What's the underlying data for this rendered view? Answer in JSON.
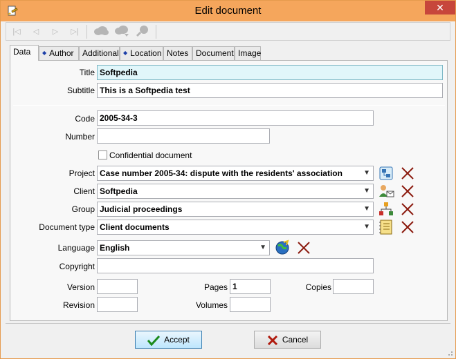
{
  "window": {
    "title": "Edit document",
    "close_glyph": "✕"
  },
  "toolbar": {
    "buttons": [
      {
        "icon": "first-record-icon",
        "glyph": "|◁"
      },
      {
        "icon": "previous-record-icon",
        "glyph": "◁"
      },
      {
        "icon": "next-record-icon",
        "glyph": "▷"
      },
      {
        "icon": "last-record-icon",
        "glyph": "▷|"
      }
    ]
  },
  "tabs": [
    {
      "label": "Data",
      "active": true,
      "dot": false
    },
    {
      "label": "Author",
      "active": false,
      "dot": true
    },
    {
      "label": "Additional",
      "active": false,
      "dot": false
    },
    {
      "label": "Location",
      "active": false,
      "dot": true
    },
    {
      "label": "Notes",
      "active": false,
      "dot": false
    },
    {
      "label": "Document",
      "active": false,
      "dot": false
    },
    {
      "label": "Image",
      "active": false,
      "dot": false
    }
  ],
  "fields": {
    "title": {
      "label": "Title",
      "value": "Softpedia"
    },
    "subtitle": {
      "label": "Subtitle",
      "value": "This is a Softpedia test"
    },
    "code": {
      "label": "Code",
      "value": "2005-34-3"
    },
    "number": {
      "label": "Number",
      "value": ""
    },
    "confidential": {
      "label": "Confidential document",
      "checked": false
    },
    "project": {
      "label": "Project",
      "value": "Case number 2005-34: dispute with the residents' association"
    },
    "client": {
      "label": "Client",
      "value": "Softpedia"
    },
    "group": {
      "label": "Group",
      "value": "Judicial proceedings"
    },
    "document_type": {
      "label": "Document type",
      "value": "Client documents"
    },
    "language": {
      "label": "Language",
      "value": "English"
    },
    "copyright": {
      "label": "Copyright",
      "value": ""
    },
    "version": {
      "label": "Version",
      "value": ""
    },
    "pages": {
      "label": "Pages",
      "value": "1"
    },
    "copies": {
      "label": "Copies",
      "value": ""
    },
    "revision": {
      "label": "Revision",
      "value": ""
    },
    "volumes": {
      "label": "Volumes",
      "value": ""
    }
  },
  "buttons": {
    "accept": "Accept",
    "cancel": "Cancel"
  },
  "colors": {
    "titlebar": "#f5a65c",
    "close": "#c7463b",
    "highlight_field": "#e1f6fa",
    "delete_x": "#8b1a0e"
  }
}
